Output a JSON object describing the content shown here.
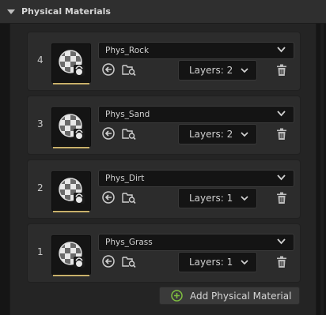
{
  "section": {
    "title": "Physical Materials",
    "collapse_icon": "chevron-down-icon"
  },
  "layers": [
    {
      "index": "4",
      "material": "Phys_Rock",
      "layers_label": "Layers: 2"
    },
    {
      "index": "3",
      "material": "Phys_Sand",
      "layers_label": "Layers: 2"
    },
    {
      "index": "2",
      "material": "Phys_Dirt",
      "layers_label": "Layers: 1"
    },
    {
      "index": "1",
      "material": "Phys_Grass",
      "layers_label": "Layers: 1"
    }
  ],
  "icons": {
    "thumbnail": "physical-material-thumbnail-icon",
    "use": "use-selected-asset-icon",
    "browse": "browse-asset-icon",
    "delete": "trash-icon",
    "dropdown": "chevron-down-icon",
    "add": "plus-circle-icon"
  },
  "colors": {
    "accent_underline": "#c8b06a",
    "add_icon": "#7fbf3f"
  },
  "add_button": {
    "label": "Add Physical Material"
  }
}
